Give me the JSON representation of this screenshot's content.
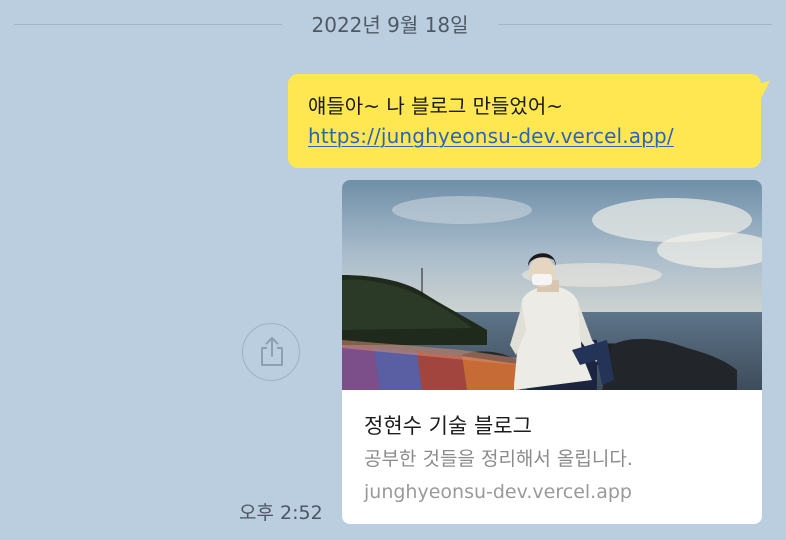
{
  "date_divider": {
    "text": "2022년 9월 18일"
  },
  "message": {
    "text": "얘들아~ 나 블로그 만들었어~",
    "link": "https://junghyeonsu-dev.vercel.app/",
    "bubble_color": "#fee751",
    "link_color": "#2f63b9"
  },
  "link_preview": {
    "title": "정현수 기술 블로그",
    "description": "공부한 것들을 정리해서 올립니다.",
    "domain": "junghyeonsu-dev.vercel.app"
  },
  "share_button": {
    "icon": "share-icon"
  },
  "timestamp": "오후 2:52",
  "colors": {
    "chat_background": "#bacee0"
  }
}
